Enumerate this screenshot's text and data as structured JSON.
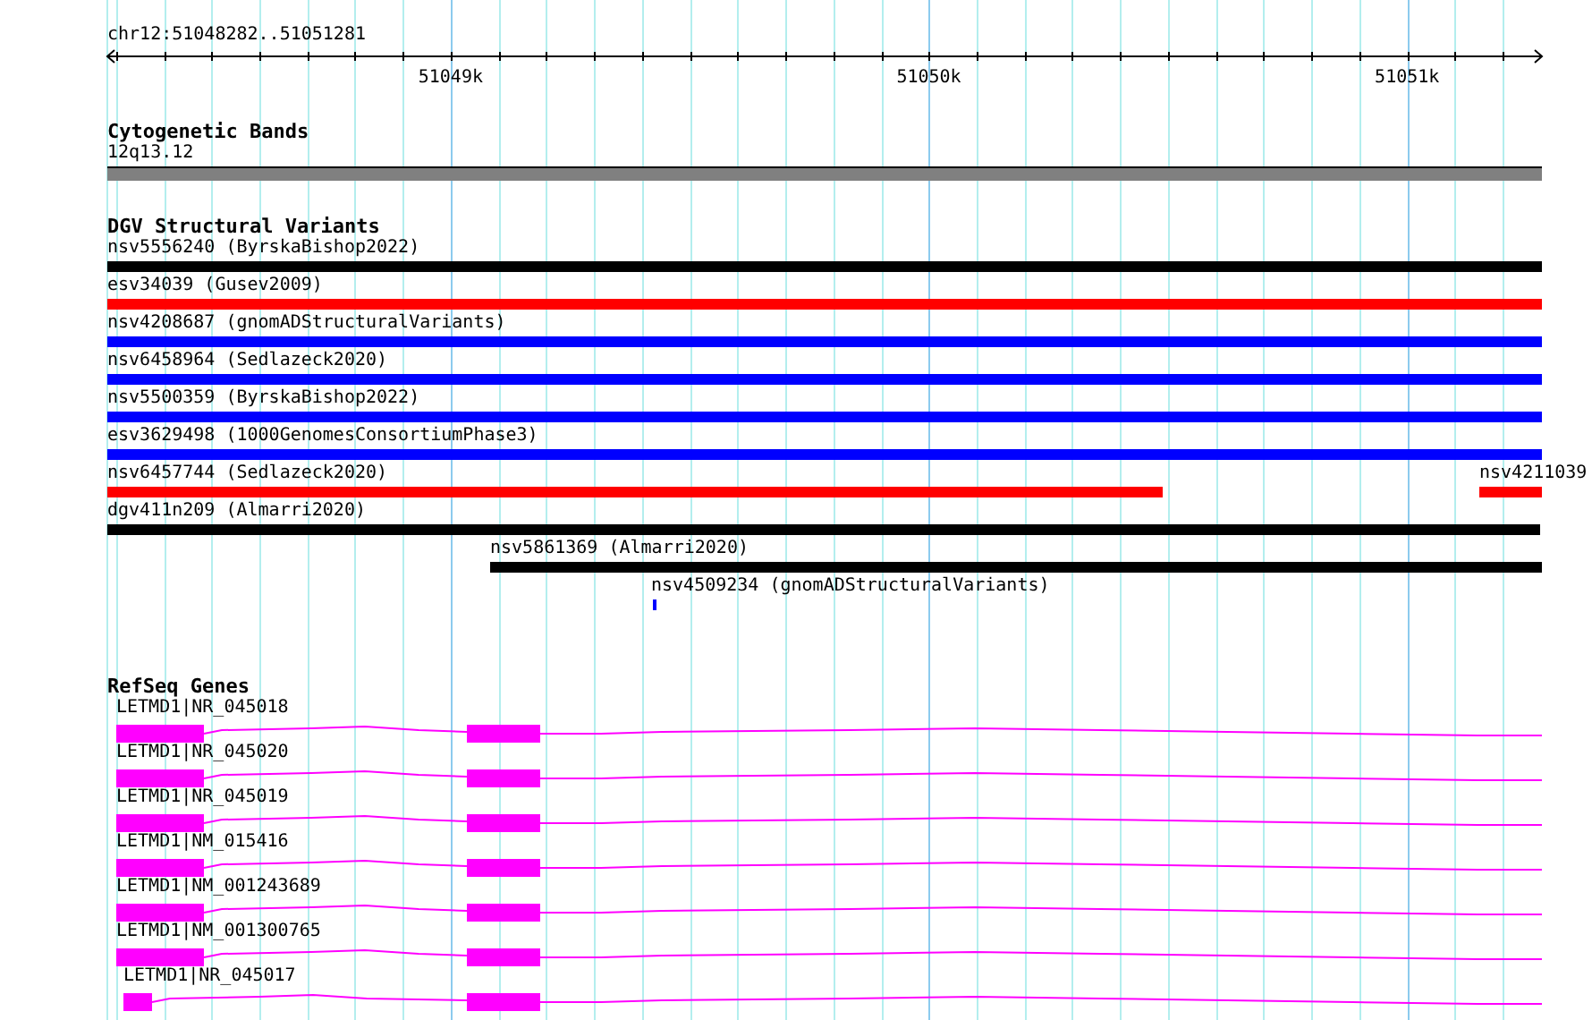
{
  "locus": "chr12:51048282..51051281",
  "ruler": {
    "labels": [
      "51049k",
      "51050k",
      "51051k"
    ]
  },
  "bands": {
    "title": "Cytogenetic Bands",
    "features": [
      {
        "label": "12q13.12"
      }
    ]
  },
  "variants": {
    "title": "DGV Structural Variants",
    "features": [
      {
        "label": "nsv5556240 (ByrskaBishop2022)",
        "color": "#000000"
      },
      {
        "label": "esv34039 (Gusev2009)",
        "color": "#ff0000"
      },
      {
        "label": "nsv4208687 (gnomADStructuralVariants)",
        "color": "#0000ff"
      },
      {
        "label": "nsv6458964 (Sedlazeck2020)",
        "color": "#0000ff"
      },
      {
        "label": "nsv5500359 (ByrskaBishop2022)",
        "color": "#0000ff"
      },
      {
        "label": "esv3629498 (1000GenomesConsortiumPhase3)",
        "color": "#0000ff"
      },
      {
        "label": "nsv6457744 (Sedlazeck2020)",
        "color": "#ff0000"
      },
      {
        "label": "nsv4211039",
        "color": "#ff0000"
      },
      {
        "label": "dgv411n209 (Almarri2020)",
        "color": "#000000"
      },
      {
        "label": "nsv5861369 (Almarri2020)",
        "color": "#000000"
      },
      {
        "label": "nsv4509234 (gnomADStructuralVariants)",
        "color": "#0000ff"
      }
    ]
  },
  "genes": {
    "title": "RefSeq Genes",
    "features": [
      {
        "label": "LETMD1|NR_045018"
      },
      {
        "label": "LETMD1|NR_045020"
      },
      {
        "label": "LETMD1|NR_045019"
      },
      {
        "label": "LETMD1|NM_015416"
      },
      {
        "label": "LETMD1|NM_001243689"
      },
      {
        "label": "LETMD1|NM_001300765"
      },
      {
        "label": "LETMD1|NR_045017"
      }
    ]
  }
}
